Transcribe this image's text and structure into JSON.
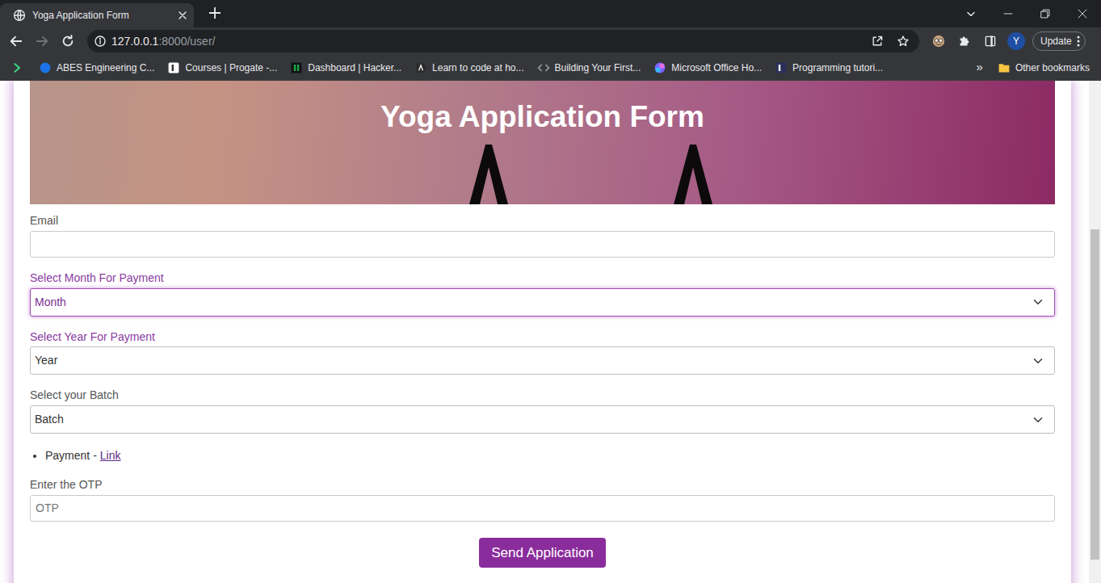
{
  "browser": {
    "tabs": [
      {
        "title": "Yoga Application Form",
        "selected": true
      }
    ],
    "back_enabled": true,
    "forward_enabled": false,
    "address": {
      "host": "127.0.0.1",
      "path": ":8000/user/"
    },
    "profile": "Y",
    "update_button": "Update",
    "bookmarks": [
      {
        "label": "ABES Engineering C...",
        "color": "#1a73e8"
      },
      {
        "label": "Courses | Progate -...",
        "color": "#ffffff"
      },
      {
        "label": "Dashboard | Hacker...",
        "color": "#1ba94c"
      },
      {
        "label": "Learn to code at ho...",
        "color": "#2b2b2b"
      },
      {
        "label": "Building Your First...",
        "color": "#9aa0a6"
      },
      {
        "label": "Microsoft Office Ho...",
        "color": "#7b61ff"
      },
      {
        "label": "Programming tutori...",
        "color": "#2c2f5b"
      }
    ],
    "bookmarks_overflow": "»",
    "other_bookmarks": "Other bookmarks"
  },
  "page": {
    "header": {
      "title": "Yoga Application Form"
    },
    "fields": [
      {
        "kind": "input",
        "label": "Email",
        "focused": false,
        "label_highlighted": false
      },
      {
        "kind": "select",
        "label": "Select Month For Payment",
        "value": "Month",
        "focused": true,
        "label_highlighted": true
      },
      {
        "kind": "select",
        "label": "Select Year For Payment",
        "value": "Year",
        "focused": false,
        "label_highlighted": true
      },
      {
        "kind": "select",
        "label": "Select your Batch",
        "value": "Batch",
        "focused": false,
        "label_highlighted": false
      },
      {
        "kind": "link",
        "text": "Payment -",
        "link": "Link"
      },
      {
        "kind": "input",
        "label": "Enter the OTP",
        "placeholder": "OTP",
        "focused": false,
        "label_highlighted": false
      }
    ],
    "submit": "Send Application",
    "scrollbar": {
      "level": 0.83
    }
  }
}
